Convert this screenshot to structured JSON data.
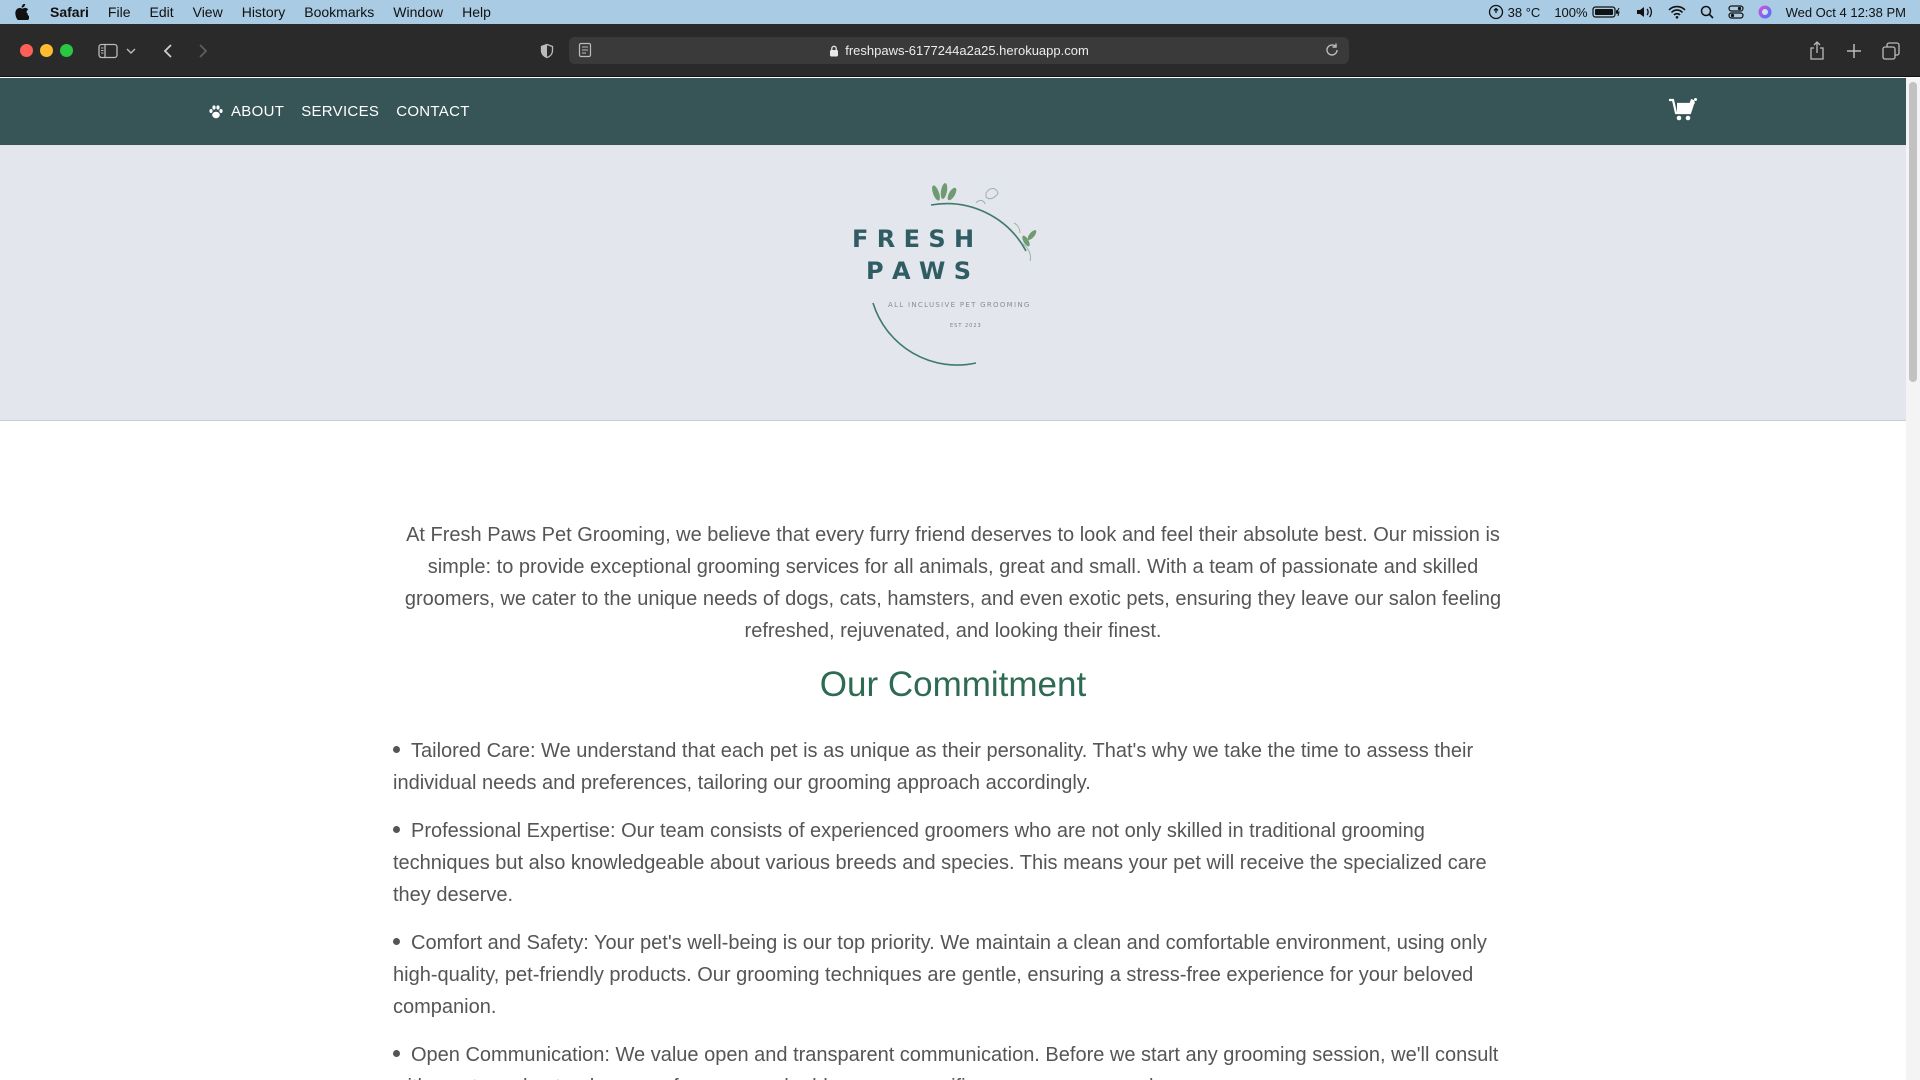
{
  "menubar": {
    "app_name": "Safari",
    "items": [
      "File",
      "Edit",
      "View",
      "History",
      "Bookmarks",
      "Window",
      "Help"
    ],
    "weather": "38 °C",
    "battery": "100%",
    "datetime": "Wed Oct 4  12:38 PM"
  },
  "browser": {
    "url": "freshpaws-6177244a2a25.herokuapp.com"
  },
  "site": {
    "nav": {
      "about": "ABOUT",
      "services": "SERVICES",
      "contact": "CONTACT"
    },
    "logo": {
      "line1": "F R E S H",
      "line2": "P A W S",
      "tagline": "ALL INCLUSIVE PET GROOMING",
      "est": "EST 2023"
    },
    "intro": "At Fresh Paws Pet Grooming, we believe that every furry friend deserves to look and feel their absolute best. Our mission is simple: to provide exceptional grooming services for all animals, great and small. With a team of passionate and skilled groomers, we cater to the unique needs of dogs, cats, hamsters, and even exotic pets, ensuring they leave our salon feeling refreshed, rejuvenated, and looking their finest.",
    "commitment_title": "Our Commitment",
    "commitments": [
      "Tailored Care: We understand that each pet is as unique as their personality. That's why we take the time to assess their individual needs and preferences, tailoring our grooming approach accordingly.",
      "Professional Expertise: Our team consists of experienced groomers who are not only skilled in traditional grooming techniques but also knowledgeable about various breeds and species. This means your pet will receive the specialized care they deserve.",
      "Comfort and Safety: Your pet's well-being is our top priority. We maintain a clean and comfortable environment, using only high-quality, pet-friendly products. Our grooming techniques are gentle, ensuring a stress-free experience for your beloved companion.",
      "Open Communication: We value open and transparent communication. Before we start any grooming session, we'll consult with you to understand your preferences and address any specific concerns you may have."
    ]
  },
  "colors": {
    "nav_bg": "#375456",
    "hero_bg": "#e3e6ec",
    "title_green": "#2e6b53",
    "body_text": "#555555"
  }
}
